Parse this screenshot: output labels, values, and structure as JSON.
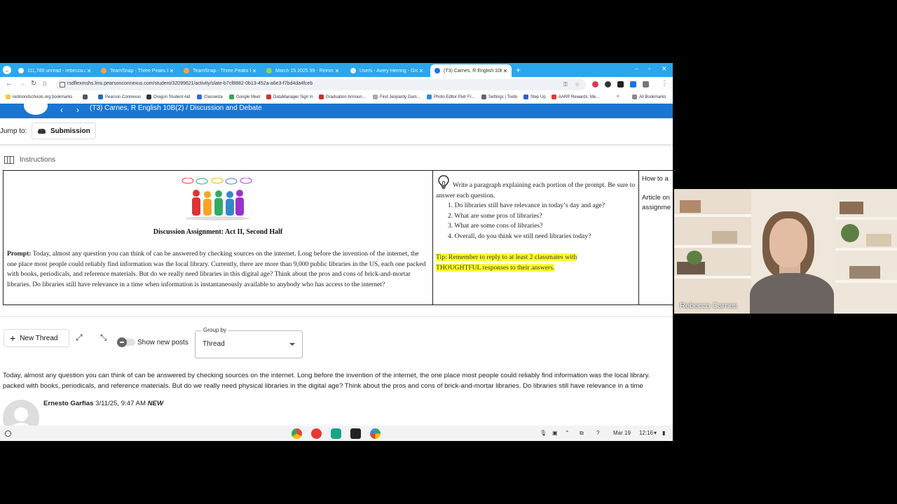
{
  "browser": {
    "tabs": [
      {
        "title": "111,789 unread - rebecca.carnes",
        "favicon_color": "#ffffff",
        "active": false
      },
      {
        "title": "TeamSnap - Three Peaks Perf",
        "favicon_color": "#f7a24a",
        "active": false
      },
      {
        "title": "TeamSnap - Three Peaks Perf",
        "favicon_color": "#f7a24a",
        "active": false
      },
      {
        "title": "March 15 2025 99 - Reining",
        "favicon_color": "#8bd35a",
        "active": false
      },
      {
        "title": "Users - Avery Herring - Grades",
        "favicon_color": "#e6f0ff",
        "active": false
      },
      {
        "title": "(T3) Carnes, R English 10B(2)",
        "favicon_color": "#1a73e8",
        "active": true
      }
    ],
    "url": "rsdflexmshs.lms.pearsonconnexus.com/student/32099621/activity/slate-b7cf8882-0b13-452a-a6e3-f7bd4da4fceb",
    "bookmarks": [
      {
        "label": "redmondschools.org bookmarks",
        "color": "#f2c94c"
      },
      {
        "label": "",
        "color": "#555555"
      },
      {
        "label": "Pearson Connexus",
        "color": "#1f6fb5"
      },
      {
        "label": "Oregon Student Aid",
        "color": "#333333"
      },
      {
        "label": "Classwize",
        "color": "#2e6fd8"
      },
      {
        "label": "Google Meet",
        "color": "#34a853"
      },
      {
        "label": "DataManager Sign In",
        "color": "#d9302c"
      },
      {
        "label": "Graduation Announ...",
        "color": "#c9302c"
      },
      {
        "label": "Find Jeopardy Gam...",
        "color": "#aaaaaa"
      },
      {
        "label": "Photo Editor Pixlr Fr...",
        "color": "#2a8fd8"
      },
      {
        "label": "Settings | Trello",
        "color": "#666666"
      },
      {
        "label": "Step Up",
        "color": "#2a60c8"
      },
      {
        "label": "AARP Rewards: Me...",
        "color": "#e53935"
      }
    ],
    "all_bookmarks": "All Bookmarks"
  },
  "header": {
    "breadcrumb": "(T3) Carnes, R English 10B(2) / Discussion and Debate"
  },
  "jump": {
    "label": "Jump to:",
    "submission": "Submission"
  },
  "instructions_label": "Instructions",
  "assignment": {
    "title": "Discussion Assignment: Act II, Second Half",
    "prompt_label": "Prompt:",
    "prompt_text": "Today, almost any question you can think of can be answered by checking sources on the internet. Long before the invention of the internet, the one place most people could reliably find information was the local library. Currently, there are more than 9,000 public libraries in the US, each one packed with books, periodicals, and reference materials. But do we really need libraries in this digital age? Think about the pros and cons of brick-and-mortar libraries. Do libraries still have relevance in a time when information is instantaneously available to anybody who has access to the internet?",
    "intro": "Write a paragraph explaining each portion of the prompt. Be sure to answer each question.",
    "questions": [
      "1.  Do libraries still have relevance in today’s day and age?",
      "2.  What are some pros of libraries?",
      "3.  What are some cons of libraries?",
      "4.  Overall, do you think we still need libraries today?"
    ],
    "tip": "Tip: Remember to reply to at least 2 classmates with THOUGHTFUL responses to their answers.",
    "col3_line1": "How to a",
    "col3_line2": "Article on",
    "col3_line3": "assignme"
  },
  "thread_controls": {
    "new_thread": "New Thread",
    "show_new_posts": "Show new posts",
    "group_by_label": "Group by",
    "group_by_value": "Thread"
  },
  "post": {
    "text_line1": "Today, almost any question you can think of can be answered by checking sources on the internet. Long before the invention of the internet, the one place most people could reliably find information was the local library.",
    "text_line2": "packed with books, periodicals, and reference materials. But do we really need physical libraries in the digital age? Think about the pros and cons of brick-and-mortar libraries. Do libraries still have relevance in a time",
    "author": "Ernesto Garfias",
    "timestamp": "3/11/25, 9:47 AM",
    "badge": "NEW"
  },
  "shelf": {
    "date": "Mar 19",
    "time": "12:16"
  },
  "video": {
    "participant_name": "Rebecca Carnes"
  },
  "colors": {
    "tab_strip": "#2aa6ec",
    "page_header": "#1976d2",
    "tip_highlight": "#ffff2e"
  }
}
